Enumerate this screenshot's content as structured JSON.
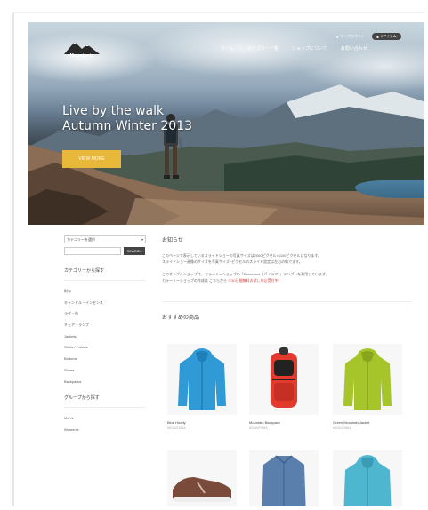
{
  "header": {
    "logo_text": "Mountania",
    "nav": [
      "ホーム",
      "カテゴリー一覧",
      "ショップについて",
      "お問い合わせ"
    ],
    "account_label": "マイアカウント",
    "cart_label": "0アイテム"
  },
  "hero": {
    "title_line1": "Live by the walk",
    "title_line2": "Autumn Winter 2013",
    "button_label": "VIEW MORE"
  },
  "sidebar": {
    "category_select": "カテゴリーを選択",
    "search_placeholder": "",
    "search_button": "SEARCH",
    "category_heading": "カテゴリーから探す",
    "categories": [
      "財布",
      "キャンドル・インセンス",
      "ラグ・布",
      "チェア・ランプ",
      "Jackets",
      "Shirts / T-shirts",
      "Bottoms",
      "Shoes",
      "Backpacks"
    ],
    "group_heading": "グループから探す",
    "groups": [
      "Men's",
      "Women's"
    ]
  },
  "main": {
    "notice_title": "お知らせ",
    "notice_line1": "このページで表示しているスライドショーの写真サイズは2000ピクセル×1100ピクセルになります。",
    "notice_line2": "スライドショー画像のサイズを写真サイズ+ピクセルのスライド設定は左右の約でます。",
    "notice_line3": "このサンプルショップは、カラーミーショップの「Panorama（パノラマ）」テンプレを利用しています。",
    "notice_line4_prefix": "カラーミーショップの作成は",
    "notice_link": "こちらから",
    "notice_red": "※30日間無料お試し申込受付中",
    "recommended_title": "おすすめの商品"
  },
  "products": [
    {
      "name": "Blue Hoody",
      "brand": "MOUNTANIA",
      "color": "#2f9ad6"
    },
    {
      "name": "Mountain Backpack",
      "brand": "MOUNTANIA",
      "color": "#e23a2d"
    },
    {
      "name": "Green Mountain Jacket",
      "brand": "MOUNTANIA",
      "color": "#a6c52a"
    },
    {
      "name": "",
      "brand": "",
      "color": "#7a4a3a"
    },
    {
      "name": "",
      "brand": "",
      "color": "#5b7fad"
    },
    {
      "name": "",
      "brand": "",
      "color": "#4fb6cf"
    }
  ],
  "colors": {
    "accent": "#e8b83a",
    "dark_button": "#444444"
  }
}
